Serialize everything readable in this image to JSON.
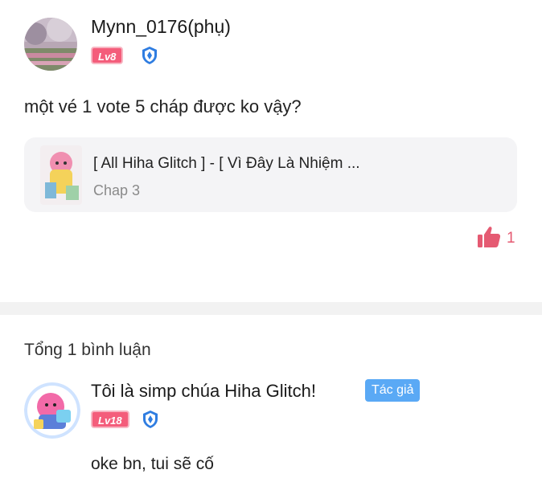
{
  "post": {
    "author": "Mynn_0176(phụ)",
    "level": "Lv8",
    "text": "một vé 1 vote 5 cháp được ko vậy?",
    "story": {
      "title": "[ All Hiha Glitch ] - [ Vì Đây Là Nhiệm ...",
      "chapter": "Chap 3"
    },
    "likes": "1"
  },
  "comments": {
    "count_label": "Tổng 1 bình luận",
    "items": [
      {
        "author": "Tôi là simp chúa Hiha Glitch!",
        "author_tag": "Tác giả",
        "level": "Lv18",
        "text": "oke bn, tui sẽ cố"
      }
    ]
  },
  "colors": {
    "level_badge": "#f45d7b",
    "author_tag": "#5aa9f5",
    "like": "#e55a72",
    "verify": "#2f7de1"
  },
  "icons": {
    "verify": "verified-shield-icon",
    "like": "thumbs-up-icon"
  }
}
